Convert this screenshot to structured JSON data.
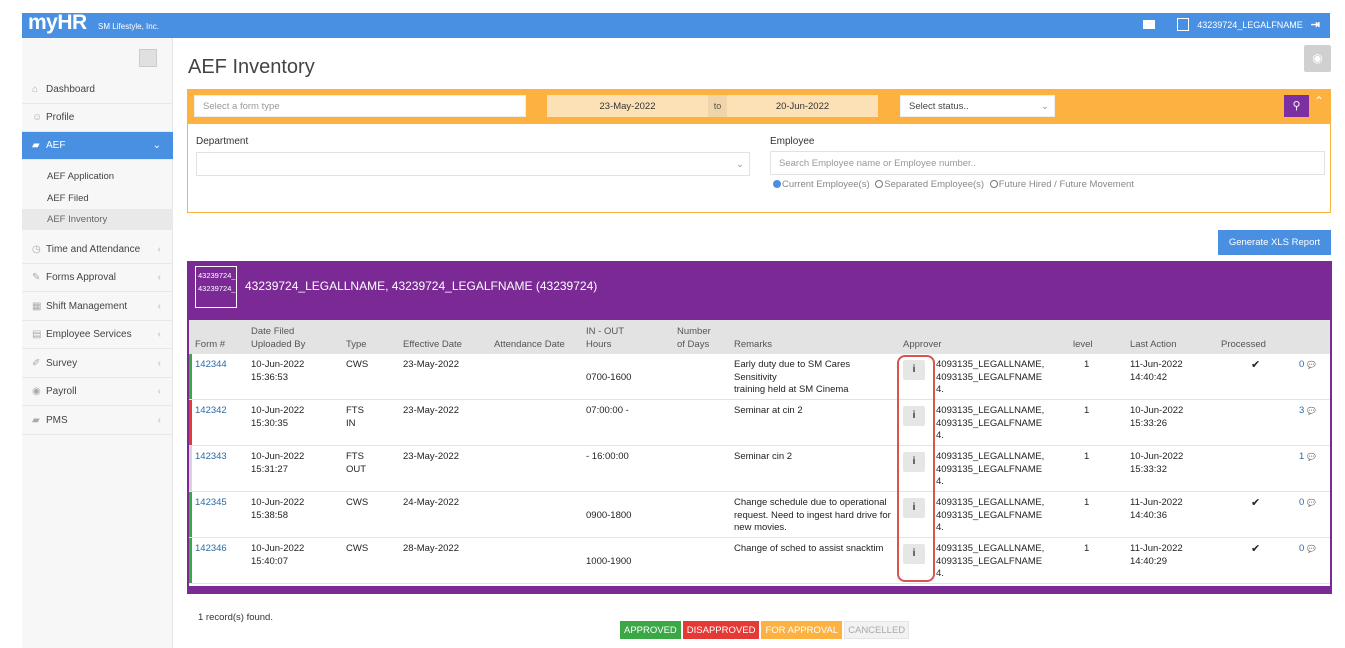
{
  "app": {
    "logo": "myHR",
    "company": "SM Lifestyle, Inc.",
    "user": "43239724_LEGALFNAME"
  },
  "sidebar": {
    "items": [
      {
        "label": "Dashboard",
        "icon": "home-icon",
        "glyph": "⌂"
      },
      {
        "label": "Profile",
        "icon": "user-icon",
        "glyph": "☺"
      },
      {
        "label": "AEF",
        "icon": "folder-icon",
        "glyph": "▰"
      },
      {
        "label": "Time and Attendance",
        "icon": "clock-icon",
        "glyph": "◷"
      },
      {
        "label": "Forms Approval",
        "icon": "pencil-icon",
        "glyph": "✎"
      },
      {
        "label": "Shift Management",
        "icon": "calendar-icon",
        "glyph": "▦"
      },
      {
        "label": "Employee Services",
        "icon": "document-icon",
        "glyph": "▤"
      },
      {
        "label": "Survey",
        "icon": "edit-icon",
        "glyph": "✐"
      },
      {
        "label": "Payroll",
        "icon": "coins-icon",
        "glyph": "◉"
      },
      {
        "label": "PMS",
        "icon": "folder-icon",
        "glyph": "▰"
      }
    ],
    "aef_sub": [
      "AEF Application",
      "AEF Filed",
      "AEF Inventory"
    ]
  },
  "page": {
    "title": "AEF Inventory"
  },
  "filters": {
    "form_type_placeholder": "Select a form type",
    "date_from": "23-May-2022",
    "to_label": "to",
    "date_to": "20-Jun-2022",
    "status_placeholder": "Select status..",
    "department_label": "Department",
    "employee_label": "Employee",
    "employee_placeholder": "Search Employee name or Employee number..",
    "radio_current": "Current Employee(s)",
    "radio_separated": "Separated Employee(s)",
    "radio_future": "Future Hired / Future Movement"
  },
  "generate_button": "Generate XLS Report",
  "employee": {
    "name": "43239724_LEGALLNAME, 43239724_LEGALFNAME (43239724)",
    "avatar_alt_1": "43239724_LEGALLNAME",
    "avatar_alt_2": "43239724_LEGALFNAME"
  },
  "table": {
    "headers": {
      "form": "Form #",
      "date_filed_1": "Date Filed",
      "date_filed_2": "Uploaded By",
      "type": "Type",
      "effective": "Effective Date",
      "attendance": "Attendance Date",
      "inout_1": "IN - OUT",
      "inout_2": "Hours",
      "days_1": "Number",
      "days_2": "of Days",
      "remarks": "Remarks",
      "approver": "Approver",
      "level": "level",
      "last_action": "Last Action",
      "processed": "Processed"
    },
    "rows": [
      {
        "form": "142344",
        "date": "10-Jun-2022",
        "time": "15:36:53",
        "type1": "CWS",
        "type2": "",
        "effective": "23-May-2022",
        "hours": "0700-1600",
        "remarks": [
          "Early duty due to SM Cares Sensitivity",
          "training held at SM Cinema"
        ],
        "approver": [
          "4093135_LEGALLNAME,",
          "4093135_LEGALFNAME",
          "4."
        ],
        "level": "1",
        "last_date": "11-Jun-2022",
        "last_time": "14:40:42",
        "processed": true,
        "comments": "0",
        "status_color": "#3aa845"
      },
      {
        "form": "142342",
        "date": "10-Jun-2022",
        "time": "15:30:35",
        "type1": "FTS",
        "type2": "IN",
        "effective": "23-May-2022",
        "hours": "07:00:00 -",
        "remarks": [
          "Seminar at cin 2"
        ],
        "approver": [
          "4093135_LEGALLNAME,",
          "4093135_LEGALFNAME",
          "4."
        ],
        "level": "1",
        "last_date": "10-Jun-2022",
        "last_time": "15:33:26",
        "processed": false,
        "comments": "3",
        "status_color": "#e53935"
      },
      {
        "form": "142343",
        "date": "10-Jun-2022",
        "time": "15:31:27",
        "type1": "FTS",
        "type2": "OUT",
        "effective": "23-May-2022",
        "hours": "- 16:00:00",
        "remarks": [
          "Seminar cin 2"
        ],
        "approver": [
          "4093135_LEGALLNAME,",
          "4093135_LEGALFNAME",
          "4."
        ],
        "level": "1",
        "last_date": "10-Jun-2022",
        "last_time": "15:33:32",
        "processed": false,
        "comments": "1",
        "status_color": "#e0cde6"
      },
      {
        "form": "142345",
        "date": "10-Jun-2022",
        "time": "15:38:58",
        "type1": "CWS",
        "type2": "",
        "effective": "24-May-2022",
        "hours": "0900-1800",
        "remarks": [
          "Change schedule due to operational",
          "request. Need to ingest hard drive for",
          "new movies."
        ],
        "approver": [
          "4093135_LEGALLNAME,",
          "4093135_LEGALFNAME",
          "4."
        ],
        "level": "1",
        "last_date": "11-Jun-2022",
        "last_time": "14:40:36",
        "processed": true,
        "comments": "0",
        "status_color": "#3aa845"
      },
      {
        "form": "142346",
        "date": "10-Jun-2022",
        "time": "15:40:07",
        "type1": "CWS",
        "type2": "",
        "effective": "28-May-2022",
        "hours": "1000-1900",
        "remarks": [
          "Change of sched to assist snacktim"
        ],
        "approver": [
          "4093135_LEGALLNAME,",
          "4093135_LEGALFNAME",
          "4."
        ],
        "level": "1",
        "last_date": "11-Jun-2022",
        "last_time": "14:40:29",
        "processed": true,
        "comments": "0",
        "status_color": "#3aa845"
      }
    ],
    "info_glyph": "i",
    "check_glyph": "✔",
    "comment_glyph": "💬"
  },
  "records_found": "1 record(s) found.",
  "legend": [
    {
      "label": "APPROVED",
      "color": "#3aa845"
    },
    {
      "label": "DISAPPROVED",
      "color": "#e53935"
    },
    {
      "label": "FOR APPROVAL",
      "color": "#fcb140"
    },
    {
      "label": "CANCELLED",
      "color": "#f2f2f2"
    }
  ]
}
